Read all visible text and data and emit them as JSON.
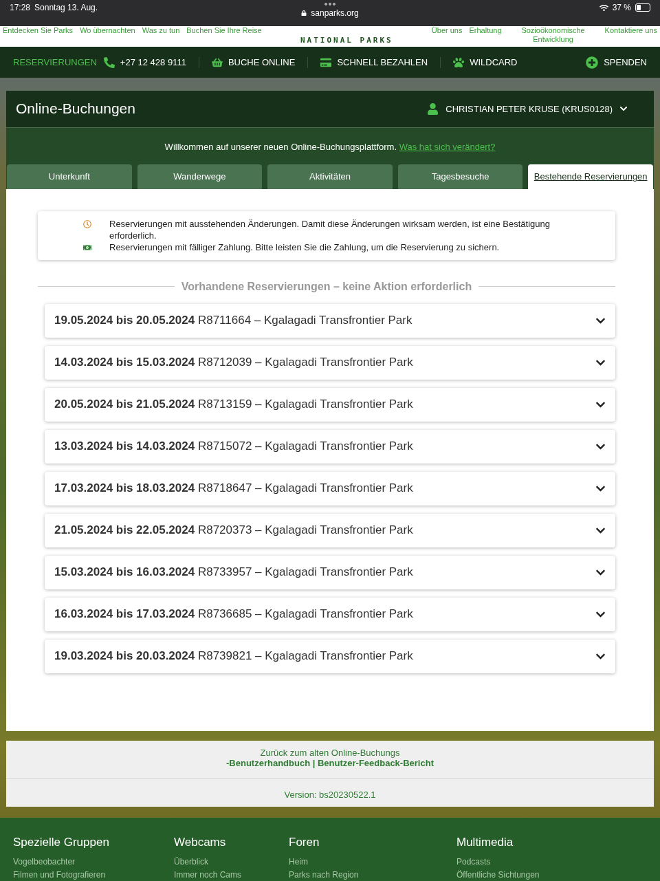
{
  "status_bar": {
    "time": "17:28",
    "date": "Sonntag 13. Aug.",
    "url": "sanparks.org",
    "battery": "37 %"
  },
  "site_nav": {
    "left": [
      "Entdecken Sie Parks",
      "Wo übernachten",
      "Was zu tun",
      "Buchen Sie Ihre Reise"
    ],
    "logo_text": "NATIONAL PARKS",
    "right": [
      "Über uns",
      "Erhaltung",
      "Sozioökonomische Entwicklung",
      "Kontaktiere uns"
    ]
  },
  "action_bar": {
    "items": [
      {
        "kind": "label",
        "label": "RESERVIERUNGEN"
      },
      {
        "kind": "phone",
        "label": "+27 12 428 9111"
      },
      {
        "kind": "basket",
        "label": "BUCHE ONLINE"
      },
      {
        "kind": "card",
        "label": "SCHNELL BEZAHLEN"
      },
      {
        "kind": "wildcard",
        "label": "WILDCARD"
      }
    ],
    "donate": "SPENDEN"
  },
  "panel": {
    "title": "Online-Buchungen",
    "user": "CHRISTIAN PETER KRUSE (KRUS0128)",
    "welcome": "Willkommen auf unserer neuen Online-Buchungsplattform.",
    "welcome_link": "Was hat sich verändert?"
  },
  "tabs": [
    {
      "label": "Unterkunft",
      "selected": false
    },
    {
      "label": "Wanderwege",
      "selected": false
    },
    {
      "label": "Aktivitäten",
      "selected": false
    },
    {
      "label": "Tagesbesuche",
      "selected": false
    },
    {
      "label": "Bestehende Reservierungen",
      "selected": true
    }
  ],
  "legend": [
    {
      "kind": "clock",
      "text": "Reservierungen mit ausstehenden Änderungen. Damit diese Änderungen wirksam werden, ist eine Bestätigung erforderlich."
    },
    {
      "kind": "money",
      "text": "Reservierungen mit fälliger Zahlung. Bitte leisten Sie die Zahlung, um die Reservierung zu sichern."
    }
  ],
  "section_heading": "Vorhandene Reservierungen – keine Aktion erforderlich",
  "reservations": [
    {
      "dates": "19.05.2024 bis 20.05.2024",
      "detail": "R8711664 – Kgalagadi Transfrontier Park"
    },
    {
      "dates": "14.03.2024 bis 15.03.2024",
      "detail": "R8712039 – Kgalagadi Transfrontier Park"
    },
    {
      "dates": "20.05.2024 bis 21.05.2024",
      "detail": "R8713159 – Kgalagadi Transfrontier Park"
    },
    {
      "dates": "13.03.2024 bis 14.03.2024",
      "detail": "R8715072 – Kgalagadi Transfrontier Park"
    },
    {
      "dates": "17.03.2024 bis 18.03.2024",
      "detail": "R8718647 – Kgalagadi Transfrontier Park"
    },
    {
      "dates": "21.05.2024 bis 22.05.2024",
      "detail": "R8720373 – Kgalagadi Transfrontier Park"
    },
    {
      "dates": "15.03.2024 bis 16.03.2024",
      "detail": "R8733957 – Kgalagadi Transfrontier Park"
    },
    {
      "dates": "16.03.2024 bis 17.03.2024",
      "detail": "R8736685 – Kgalagadi Transfrontier Park"
    },
    {
      "dates": "19.03.2024 bis 20.03.2024",
      "detail": "R8739821 – Kgalagadi Transfrontier Park"
    }
  ],
  "bottom_links": {
    "line1": "Zurück zum alten Online-Buchungs",
    "line2": "-Benutzerhandbuch | Benutzer-Feedback-Bericht",
    "version": "Version: bs20230522.1"
  },
  "footer": [
    {
      "title": "Spezielle Gruppen",
      "links": [
        "Vogelbeobachter",
        "Filmen und Fotografieren"
      ]
    },
    {
      "title": "Webcams",
      "links": [
        "Überblick",
        "Immer noch Cams"
      ]
    },
    {
      "title": "Foren",
      "links": [
        "Heim",
        "Parks nach Region"
      ]
    },
    {
      "title": "Multimedia",
      "links": [
        "Podcasts",
        "Öffentliche Sichtungen"
      ]
    }
  ]
}
